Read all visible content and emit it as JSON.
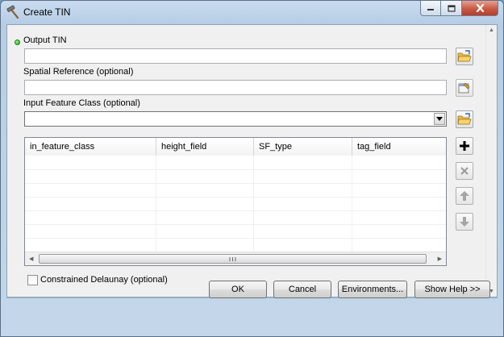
{
  "window": {
    "title": "Create TIN"
  },
  "params": {
    "output_tin": {
      "label": "Output TIN",
      "value": ""
    },
    "spatial_reference": {
      "label": "Spatial Reference (optional)",
      "value": ""
    },
    "input_feature_class": {
      "label": "Input Feature Class (optional)",
      "value": ""
    }
  },
  "table": {
    "columns": [
      "in_feature_class",
      "height_field",
      "SF_type",
      "tag_field"
    ],
    "rows": [
      [
        "",
        "",
        "",
        ""
      ],
      [
        "",
        "",
        "",
        ""
      ],
      [
        "",
        "",
        "",
        ""
      ],
      [
        "",
        "",
        "",
        ""
      ],
      [
        "",
        "",
        "",
        ""
      ],
      [
        "",
        "",
        "",
        ""
      ],
      [
        "",
        "",
        "",
        ""
      ]
    ]
  },
  "constrained_delaunay": {
    "label": "Constrained Delaunay (optional)",
    "checked": false
  },
  "buttons": {
    "ok": "OK",
    "cancel": "Cancel",
    "environments": "Environments...",
    "show_help": "Show Help >>"
  }
}
